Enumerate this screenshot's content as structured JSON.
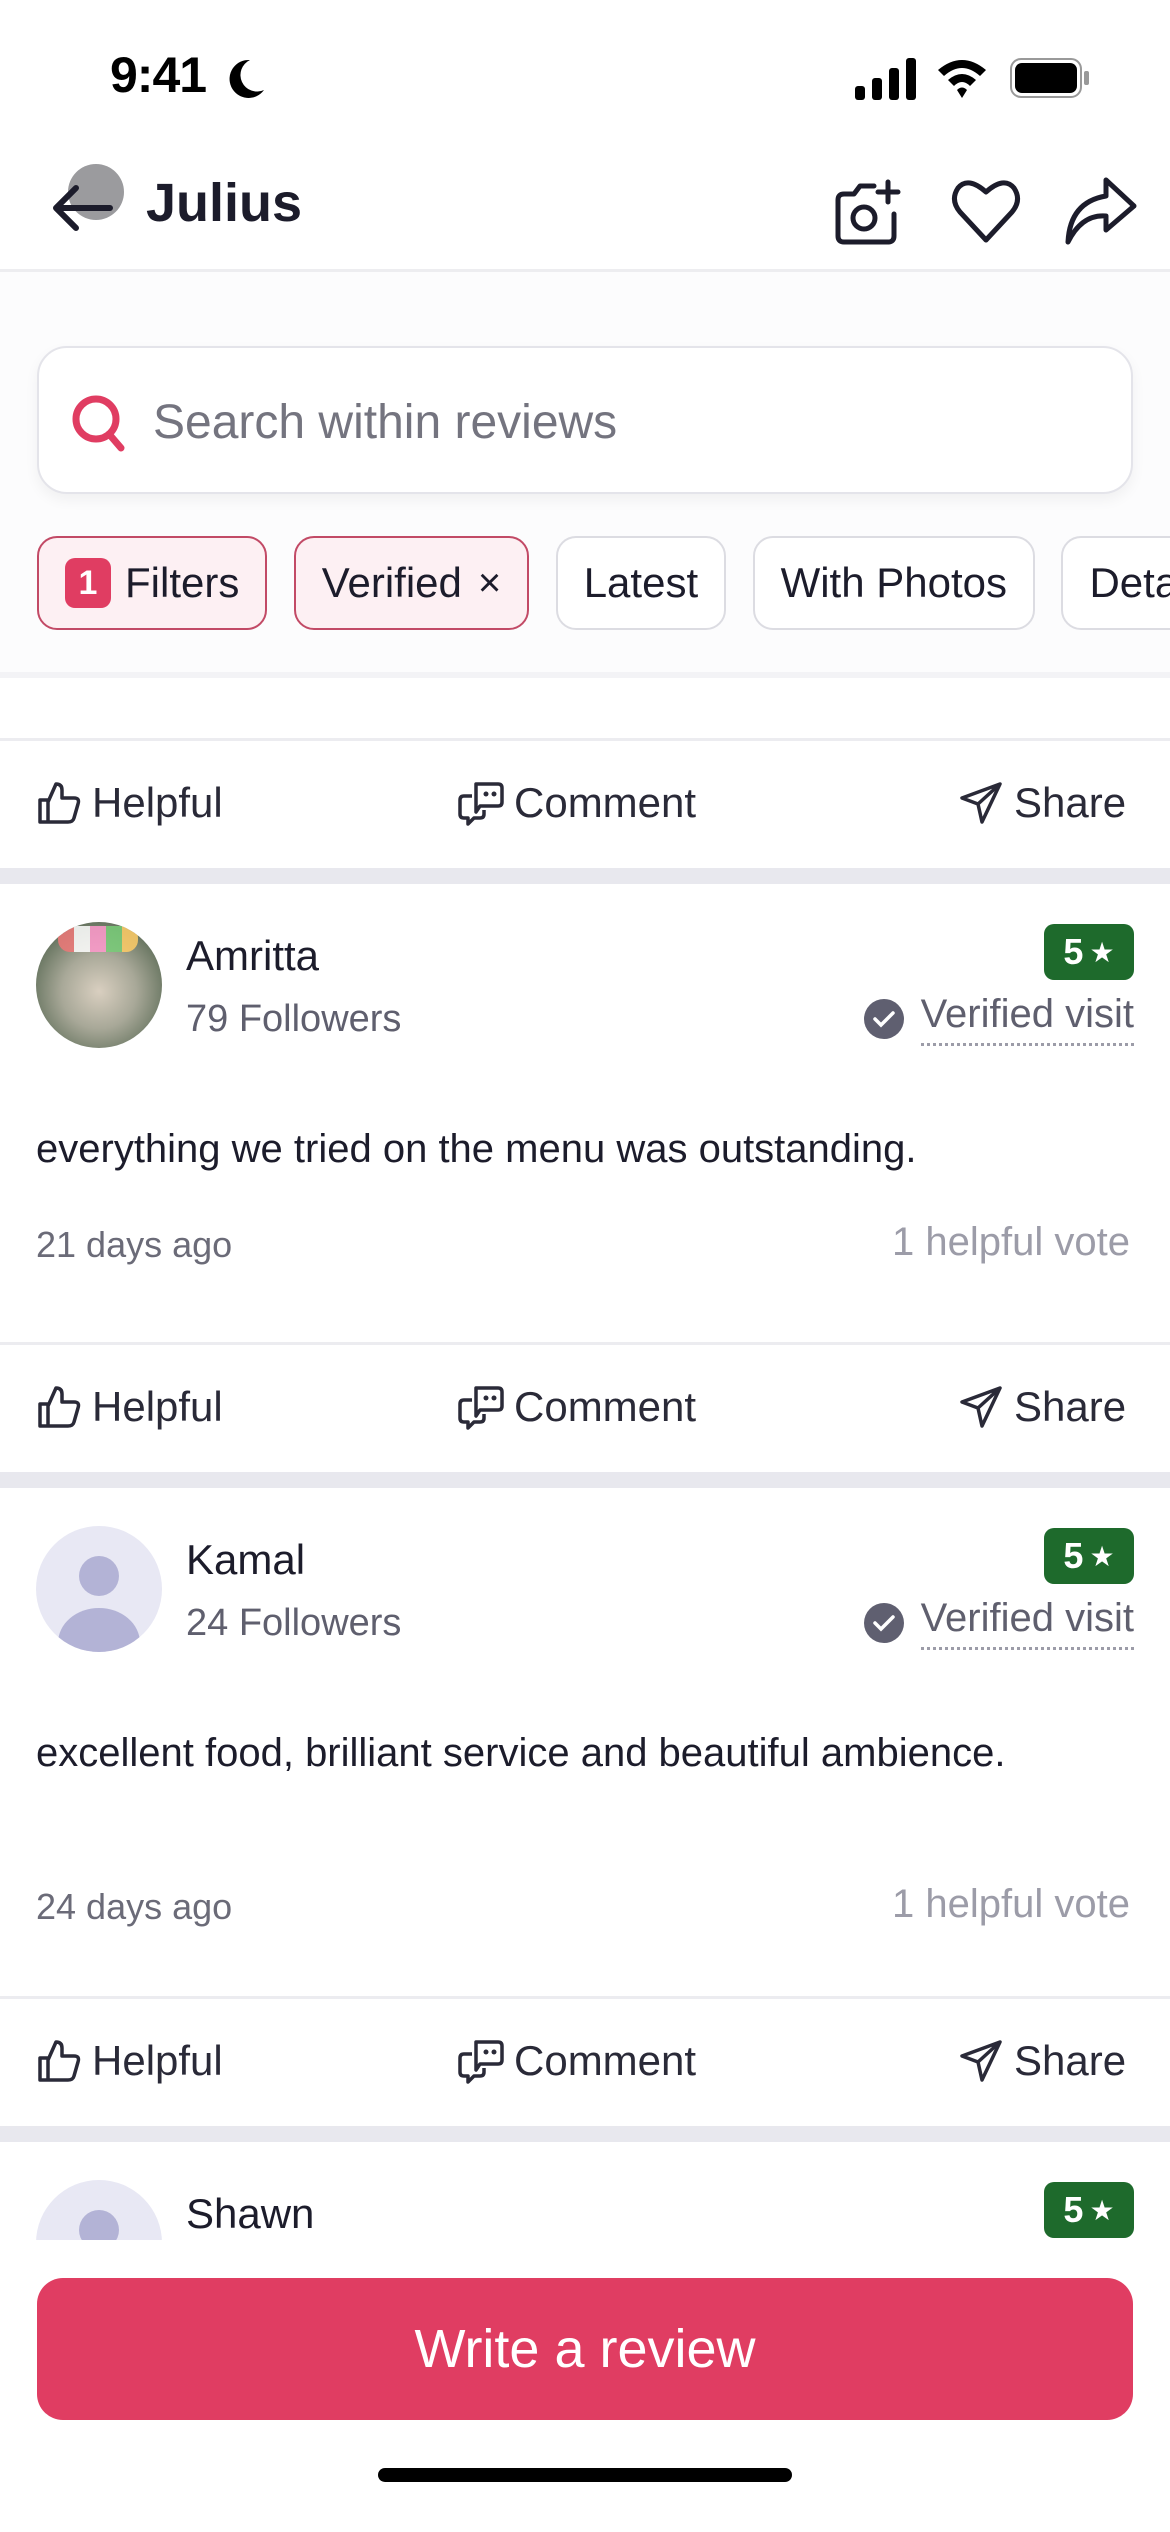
{
  "status_bar": {
    "time": "9:41"
  },
  "nav": {
    "title": "Julius"
  },
  "search": {
    "placeholder": "Search within reviews",
    "value": ""
  },
  "filters": {
    "chips": [
      {
        "label": "Filters",
        "badge": "1",
        "active": true
      },
      {
        "label": "Verified",
        "active": true,
        "removable": true,
        "remove_glyph": "×"
      },
      {
        "label": "Latest",
        "active": false
      },
      {
        "label": "With Photos",
        "active": false
      },
      {
        "label": "Detailed",
        "active": false
      }
    ]
  },
  "actions": {
    "helpful": "Helpful",
    "comment": "Comment",
    "share": "Share"
  },
  "reviews": [
    {
      "name": "Amritta",
      "followers": "79 Followers",
      "rating": "5",
      "verified_label": "Verified visit",
      "text": "everything we tried on the menu was outstanding.",
      "time_ago": "21 days ago",
      "helpful_votes": "1 helpful vote",
      "avatar": "photo"
    },
    {
      "name": "Kamal",
      "followers": "24 Followers",
      "rating": "5",
      "verified_label": "Verified visit",
      "text": "excellent food, brilliant service and beautiful ambience.",
      "time_ago": "24 days ago",
      "helpful_votes": "1 helpful vote",
      "avatar": "default"
    },
    {
      "name": "Shawn",
      "rating": "5",
      "avatar": "default"
    }
  ],
  "cta": {
    "label": "Write a review"
  },
  "colors": {
    "brand": "#e03d62",
    "rating_green": "#1e6a2c",
    "chip_active_border": "#c24a66",
    "chip_active_bg": "#fdf0f3",
    "text_primary": "#1c1c2b",
    "text_secondary": "#5f5f6e"
  }
}
